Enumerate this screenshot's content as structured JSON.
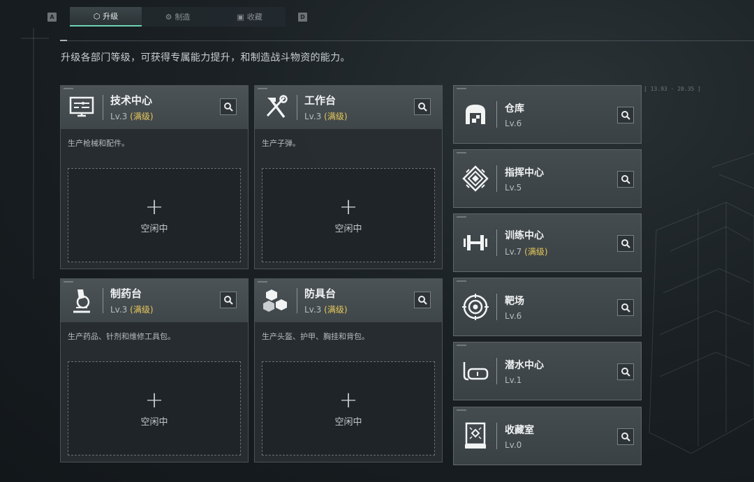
{
  "tabs": {
    "left_key": "A",
    "right_key": "D",
    "items": [
      {
        "label": "升级",
        "icon": "upgrade-icon",
        "active": true
      },
      {
        "label": "制造",
        "icon": "gear-icon",
        "active": false
      },
      {
        "label": "收藏",
        "icon": "collection-icon",
        "active": false
      }
    ]
  },
  "description": "升级各部门等级，可获得专属能力提升，和制造战斗物资的能力。",
  "coord_readout": "[ 13.93 · 20.35 ]",
  "cards": [
    {
      "title": "技术中心",
      "level": "Lv.3",
      "max": "(满级)",
      "desc": "生产枪械和配件。",
      "plus": "+",
      "status": "空闲中",
      "icon": "computer-icon"
    },
    {
      "title": "工作台",
      "level": "Lv.3",
      "max": "(满级)",
      "desc": "生产子弹。",
      "plus": "+",
      "status": "空闲中",
      "icon": "hammer-wrench-icon"
    },
    {
      "title": "制药台",
      "level": "Lv.3",
      "max": "(满级)",
      "desc": "生产药品、针剂和维修工具包。",
      "plus": "+",
      "status": "空闲中",
      "icon": "microscope-icon"
    },
    {
      "title": "防具台",
      "level": "Lv.3",
      "max": "(满级)",
      "desc": "生产头盔、护甲、胸挂和背包。",
      "plus": "+",
      "status": "空闲中",
      "icon": "boxes-icon"
    }
  ],
  "facilities": [
    {
      "title": "仓库",
      "level": "Lv.6",
      "max": "",
      "icon": "warehouse-icon"
    },
    {
      "title": "指挥中心",
      "level": "Lv.5",
      "max": "",
      "icon": "command-emblem-icon"
    },
    {
      "title": "训练中心",
      "level": "Lv.7",
      "max": "(满级)",
      "icon": "dumbbell-icon"
    },
    {
      "title": "靶场",
      "level": "Lv.6",
      "max": "",
      "icon": "target-icon"
    },
    {
      "title": "潜水中心",
      "level": "Lv.1",
      "max": "",
      "icon": "diving-mask-icon"
    },
    {
      "title": "收藏室",
      "level": "Lv.0",
      "max": "",
      "icon": "display-case-icon"
    }
  ],
  "colors": {
    "accent": "#6fd3b4",
    "max_level": "#e6c85a"
  }
}
